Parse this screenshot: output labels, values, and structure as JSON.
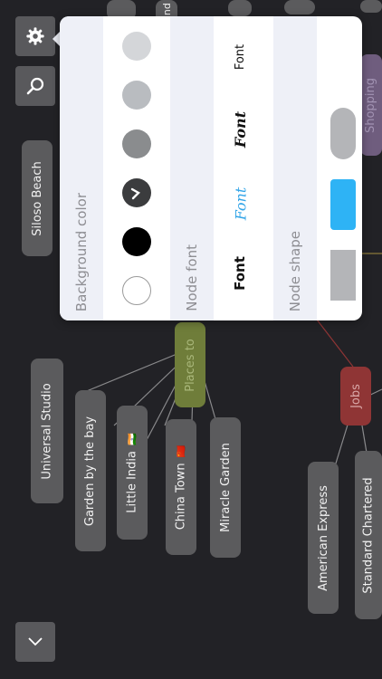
{
  "toolbar": {
    "settings_icon": "gear-icon",
    "search_icon": "search-icon",
    "expand_icon": "chevron-down-icon"
  },
  "nodes": {
    "top_partial_1": "",
    "top_partial_2": "and",
    "siloso": "Siloso Beach",
    "universal": "Universal Studio",
    "garden": "Garden by the bay",
    "little_india": "Little India",
    "china_town": "China Town",
    "miracle": "Miracle Garden",
    "places": "Places to",
    "jobs": "Jobs",
    "amex": "American Express",
    "standard": "Standard Chartered",
    "shopping": "Shopping"
  },
  "popover": {
    "background_color": {
      "label": "Background color",
      "swatches": [
        "#d4d6d9",
        "#b9bcc0",
        "#8a8c8e",
        "#3b3c3e",
        "#000000",
        "#ffffff"
      ],
      "selected_index": 3
    },
    "node_font": {
      "label": "Node font",
      "options": [
        "Font",
        "Font",
        "Font",
        "Font"
      ],
      "selected_index": 1,
      "accent": "#33a5e8"
    },
    "node_shape": {
      "label": "Node shape",
      "accent": "#2eb3f5"
    }
  }
}
